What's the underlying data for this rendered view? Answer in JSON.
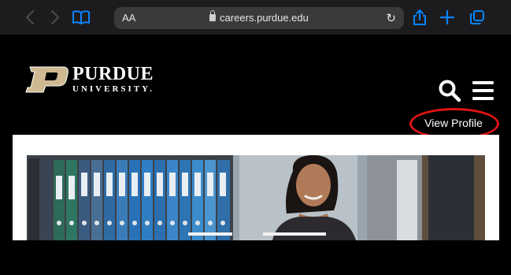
{
  "browser": {
    "text_size_label": "AA",
    "url": "careers.purdue.edu"
  },
  "site": {
    "logo_line1": "PURDUE",
    "logo_line2": "UNIVERSITY.",
    "view_profile_label": "View Profile"
  },
  "colors": {
    "toolbar_bg": "#1c1c1e",
    "accent_blue": "#0a84ff",
    "highlight_red": "#e01414",
    "purdue_gold": "#cfb991"
  },
  "icons": [
    "back-icon",
    "forward-icon",
    "bookmarks-icon",
    "lock-icon",
    "reload-icon",
    "share-icon",
    "new-tab-icon",
    "tabs-icon",
    "search-icon",
    "menu-icon"
  ]
}
